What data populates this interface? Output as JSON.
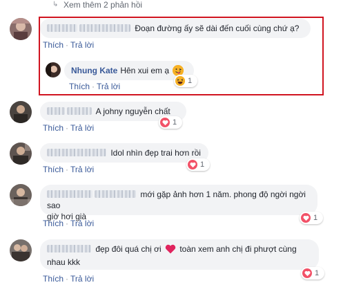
{
  "thread": {
    "more_replies": "Xem thêm 2 phản hồi"
  },
  "labels": {
    "like": "Thích",
    "reply": "Trả lời",
    "dot": "·"
  },
  "comments": [
    {
      "text": "Đoạn đường ấy sẽ dài đến cuối cùng chứ ạ?"
    },
    {
      "author": "Nhung Kate",
      "text": "Hên xui em ạ",
      "reaction_count": "1",
      "reaction": "haha-icon"
    },
    {
      "text": "A johny nguyễn chất",
      "reaction_count": "1",
      "reaction": "heart-icon"
    },
    {
      "text": "Idol nhìn đẹp trai hơn rồi",
      "reaction_count": "1",
      "reaction": "heart-icon"
    },
    {
      "text_line1": "mới gặp ảnh hơn 1 năm. phong độ ngời ngời sao",
      "text_line2": "giờ hơi già",
      "reaction_count": "1",
      "reaction": "heart-icon"
    },
    {
      "text_part1": "đẹp đôi quá chị ơi",
      "text_part2": "toàn xem anh chị đi phượt cùng",
      "text_line2": "nhau kkk",
      "reaction_count": "1",
      "reaction": "heart-icon"
    }
  ],
  "colors": {
    "accent": "#385898",
    "highlight": "#d0131f",
    "heart": "#f25268",
    "haha": "#f7b125"
  }
}
